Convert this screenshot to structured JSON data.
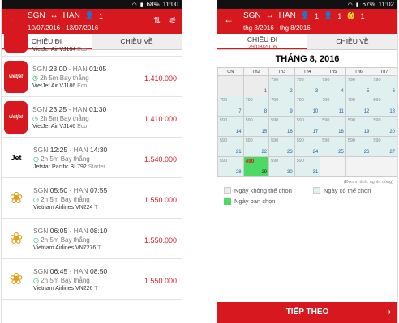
{
  "statusbar": {
    "battery": "68%",
    "time": "11:00"
  },
  "statusbar_right": {
    "battery": "67%",
    "time": "11:02"
  },
  "left": {
    "header": {
      "from": "SGN",
      "arrow": "↔",
      "to": "HAN",
      "pax": "1",
      "dates": "10/07/2016 - 13/07/2016"
    },
    "tabs": {
      "outbound": "CHIỀU ĐI",
      "return": "CHIỀU VỀ"
    },
    "flights": [
      {
        "logo": "vietjet",
        "logo_text": "",
        "dep": "",
        "arr": "",
        "duration": "",
        "stop": "",
        "airline": "VietJet Air",
        "code": "VJ184",
        "cls": "Eco",
        "price": ""
      },
      {
        "logo": "vietjet",
        "logo_text": "vietjet",
        "from": "SGN",
        "dep": "23:00",
        "to": "HAN",
        "arr": "01:05",
        "duration": "2h 5m",
        "stop": "Bay thẳng",
        "airline": "VietJet Air",
        "code": "VJ186",
        "cls": "Eco",
        "price": "1.410.000"
      },
      {
        "logo": "vietjet",
        "logo_text": "vietjet",
        "from": "SGN",
        "dep": "23:25",
        "to": "HAN",
        "arr": "01:30",
        "duration": "2h 5m",
        "stop": "Bay thẳng",
        "airline": "VietJet Air",
        "code": "VJ146",
        "cls": "Eco",
        "price": "1.410.000"
      },
      {
        "logo": "jetstar",
        "logo_text": "Jet",
        "from": "SGN",
        "dep": "12:25",
        "to": "HAN",
        "arr": "14:30",
        "duration": "2h 5m",
        "stop": "Bay thẳng",
        "airline": "Jetstar Pacific",
        "code": "BL792",
        "cls": "Starter",
        "price": "1.540.000"
      },
      {
        "logo": "vna",
        "logo_text": "❀",
        "from": "SGN",
        "dep": "05:50",
        "to": "HAN",
        "arr": "07:55",
        "duration": "2h 5m",
        "stop": "Bay thẳng",
        "airline": "Vietnam Airlines",
        "code": "VN224",
        "cls": "T",
        "price": "1.550.000"
      },
      {
        "logo": "vna",
        "logo_text": "❀",
        "from": "SGN",
        "dep": "06:05",
        "to": "HAN",
        "arr": "08:10",
        "duration": "2h 5m",
        "stop": "Bay thẳng",
        "airline": "Vietnam Airlines",
        "code": "VN7276",
        "cls": "T",
        "price": "1.550.000"
      },
      {
        "logo": "vna",
        "logo_text": "❀",
        "from": "SGN",
        "dep": "06:45",
        "to": "HAN",
        "arr": "08:50",
        "duration": "2h 5m",
        "stop": "Bay thẳng",
        "airline": "Vietnam Airlines",
        "code": "VN226",
        "cls": "T",
        "price": "1.550.000"
      }
    ]
  },
  "right": {
    "header": {
      "from": "SGN",
      "arrow": "↔",
      "to": "HAN",
      "pax_adult": "1",
      "pax_child": "1",
      "pax_infant": "1",
      "dates": "thg 8/2016 - thg 8/2016"
    },
    "tabs": {
      "outbound": "CHIỀU ĐI",
      "outbound_date": "29/08/2016",
      "return": "CHIỀU VỀ"
    },
    "calendar": {
      "title": "THÁNG 8, 2016",
      "weekdays": [
        "CN",
        "Th2",
        "Th3",
        "Th4",
        "Th5",
        "Th6",
        "Th7"
      ],
      "weeks": [
        [
          {
            "s": "disabled",
            "p": "",
            "d": ""
          },
          {
            "s": "disabled",
            "p": "",
            "d": "1"
          },
          {
            "s": "avail",
            "p": "790",
            "d": "2"
          },
          {
            "s": "avail",
            "p": "790",
            "d": "3"
          },
          {
            "s": "avail",
            "p": "790",
            "d": "4"
          },
          {
            "s": "avail",
            "p": "790",
            "d": "5"
          },
          {
            "s": "avail",
            "p": "790",
            "d": "6"
          }
        ],
        [
          {
            "s": "avail",
            "p": "790",
            "d": "7"
          },
          {
            "s": "avail",
            "p": "790",
            "d": "8"
          },
          {
            "s": "avail",
            "p": "790",
            "d": "9"
          },
          {
            "s": "avail",
            "p": "790",
            "d": "10"
          },
          {
            "s": "avail",
            "p": "790",
            "d": "11"
          },
          {
            "s": "avail",
            "p": "790",
            "d": "12"
          },
          {
            "s": "avail",
            "p": "590",
            "d": "13"
          }
        ],
        [
          {
            "s": "avail",
            "p": "590",
            "d": "14"
          },
          {
            "s": "avail",
            "p": "590",
            "d": "15"
          },
          {
            "s": "avail",
            "p": "590",
            "d": "16"
          },
          {
            "s": "avail",
            "p": "590",
            "d": "17"
          },
          {
            "s": "avail",
            "p": "590",
            "d": "18"
          },
          {
            "s": "avail",
            "p": "590",
            "d": "19"
          },
          {
            "s": "avail",
            "p": "590",
            "d": "20"
          }
        ],
        [
          {
            "s": "avail",
            "p": "590",
            "d": "21"
          },
          {
            "s": "avail",
            "p": "590",
            "d": "22"
          },
          {
            "s": "avail",
            "p": "590",
            "d": "23"
          },
          {
            "s": "avail",
            "p": "590",
            "d": "24"
          },
          {
            "s": "avail",
            "p": "590",
            "d": "25"
          },
          {
            "s": "avail",
            "p": "590",
            "d": "26"
          },
          {
            "s": "avail",
            "p": "590",
            "d": "27"
          }
        ],
        [
          {
            "s": "avail",
            "p": "590",
            "d": "28"
          },
          {
            "s": "selected",
            "p": "490",
            "d": "29"
          },
          {
            "s": "avail",
            "p": "590",
            "d": "30"
          },
          {
            "s": "avail",
            "p": "590",
            "d": "31"
          },
          {
            "s": "empty",
            "p": "",
            "d": ""
          },
          {
            "s": "empty",
            "p": "",
            "d": ""
          },
          {
            "s": "empty",
            "p": "",
            "d": ""
          }
        ]
      ],
      "unit_note": "(Đơn vị tính: nghìn đồng)"
    },
    "legend": {
      "unavailable": "Ngày không thể chọn",
      "available": "Ngày có thể chọn",
      "selected": "Ngày bạn chọn"
    },
    "colors": {
      "unavailable": "#ececec",
      "available": "#dff0ef",
      "selected": "#4cd964"
    },
    "cta": "TIẾP THEO"
  }
}
